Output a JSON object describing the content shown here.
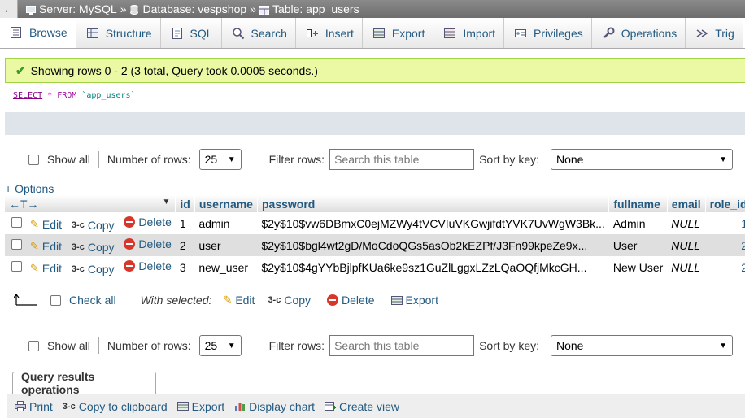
{
  "breadcrumb": {
    "back": "←",
    "server": "Server: MySQL",
    "database": "Database: vespshop",
    "table": "Table: app_users",
    "sep": "»"
  },
  "tabs": [
    {
      "label": "Browse",
      "icon": "browse-icon"
    },
    {
      "label": "Structure",
      "icon": "structure-icon"
    },
    {
      "label": "SQL",
      "icon": "sql-icon"
    },
    {
      "label": "Search",
      "icon": "search-icon"
    },
    {
      "label": "Insert",
      "icon": "insert-icon"
    },
    {
      "label": "Export",
      "icon": "export-icon"
    },
    {
      "label": "Import",
      "icon": "import-icon"
    },
    {
      "label": "Privileges",
      "icon": "privileges-icon"
    },
    {
      "label": "Operations",
      "icon": "operations-icon"
    },
    {
      "label": "Trig",
      "icon": "triggers-icon"
    }
  ],
  "notice": "Showing rows 0 - 2 (3 total, Query took 0.0005 seconds.)",
  "sql": {
    "select": "SELECT",
    "star": "*",
    "from": "FROM",
    "table": "`app_users`"
  },
  "nav": {
    "show_all": "Show all",
    "num_rows_label": "Number of rows:",
    "num_rows_value": "25",
    "filter_label": "Filter rows:",
    "filter_placeholder": "Search this table",
    "sort_label": "Sort by key:",
    "sort_value": "None"
  },
  "options": "+ Options",
  "columns": {
    "arrows": "←T→",
    "id": "id",
    "username": "username",
    "password": "password",
    "fullname": "fullname",
    "email": "email",
    "role_id": "role_id"
  },
  "actions": {
    "edit": "Edit",
    "copy": "Copy",
    "delete": "Delete"
  },
  "rows": [
    {
      "id": "1",
      "username": "admin",
      "password": "$2y$10$vw6DBmxC0ejMZWy4tVCVIuVKGwjifdtYVK7UvWgW3Bk...",
      "fullname": "Admin",
      "email": "NULL",
      "role_id": "1"
    },
    {
      "id": "2",
      "username": "user",
      "password": "$2y$10$bgl4wt2gD/MoCdoQGs5asOb2kEZPf/J3Fn99kpeZe9x...",
      "fullname": "User",
      "email": "NULL",
      "role_id": "2"
    },
    {
      "id": "3",
      "username": "new_user",
      "password": "$2y$10$4gYYbBjlpfKUa6ke9sz1GuZlLggxLZzLQaOQfjMkcGH...",
      "fullname": "New User",
      "email": "NULL",
      "role_id": "2"
    }
  ],
  "with_selected": {
    "check_all": "Check all",
    "label": "With selected:",
    "edit": "Edit",
    "copy": "Copy",
    "delete": "Delete",
    "export": "Export"
  },
  "query_ops": {
    "legend": "Query results operations",
    "print": "Print",
    "copy_clipboard": "Copy to clipboard",
    "export": "Export",
    "display_chart": "Display chart",
    "create_view": "Create view"
  }
}
